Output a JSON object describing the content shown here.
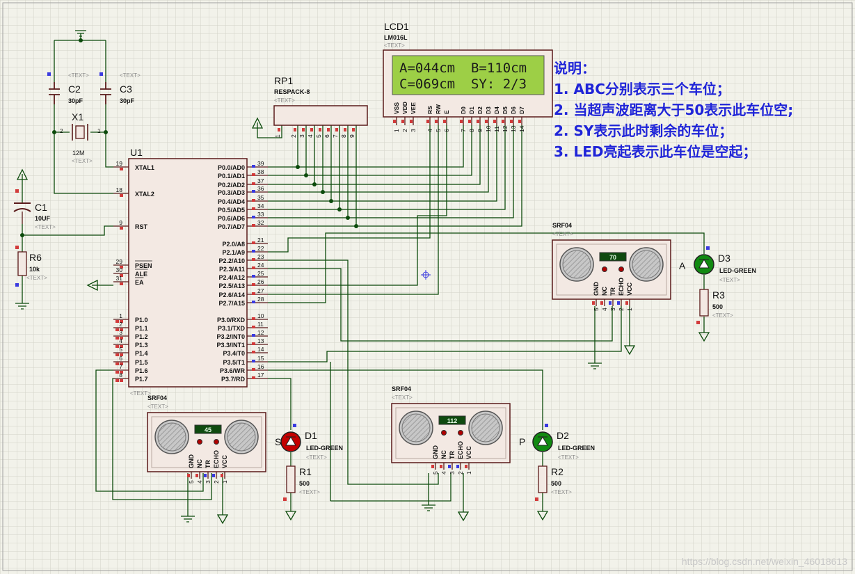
{
  "lcd": {
    "ref": "LCD1",
    "model": "LM016L",
    "text_tag": "<TEXT>",
    "line1": "A=044cm  B=110cm",
    "line2": "C=069cm  SY: 2/3",
    "pins": [
      "VSS",
      "VDD",
      "VEE",
      "RS",
      "RW",
      "E",
      "D0",
      "D1",
      "D2",
      "D3",
      "D4",
      "D5",
      "D6",
      "D7"
    ],
    "pin_numbers": [
      "1",
      "2",
      "3",
      "4",
      "5",
      "6",
      "7",
      "8",
      "9",
      "10",
      "11",
      "12",
      "13",
      "14"
    ]
  },
  "description": {
    "title": "说明：",
    "lines": [
      "1. ABC分别表示三个车位；",
      "2. 当超声波距离大于50表示此车位空;",
      "2. SY表示此时剩余的车位；",
      "3. LED亮起表示此车位是空起；"
    ]
  },
  "rp1": {
    "ref": "RP1",
    "model": "RESPACK-8",
    "text_tag": "<TEXT>",
    "pins": [
      "1",
      "2",
      "3",
      "4",
      "5",
      "6",
      "7",
      "8",
      "9"
    ]
  },
  "c2": {
    "ref": "C2",
    "value": "30pF",
    "text_tag": "<TEXT>"
  },
  "c3": {
    "ref": "C3",
    "value": "30pF",
    "text_tag": "<TEXT>"
  },
  "x1": {
    "ref": "X1",
    "value": "12M",
    "text_tag": "<TEXT>",
    "pin_left": "2",
    "pin_right": "1"
  },
  "c1": {
    "ref": "C1",
    "value": "10UF",
    "text_tag": "<TEXT>"
  },
  "r6": {
    "ref": "R6",
    "value": "10k",
    "text_tag": "<TEXT>"
  },
  "u1": {
    "ref": "U1",
    "text_tag": "<TEXT>",
    "left_pins": [
      {
        "num": "19",
        "name": "XTAL1"
      },
      {
        "num": "18",
        "name": "XTAL2"
      },
      {
        "num": "9",
        "name": "RST"
      },
      {
        "num": "29",
        "name": "PSEN"
      },
      {
        "num": "30",
        "name": "ALE"
      },
      {
        "num": "31",
        "name": "EA"
      },
      {
        "num": "1",
        "name": "P1.0"
      },
      {
        "num": "2",
        "name": "P1.1"
      },
      {
        "num": "3",
        "name": "P1.2"
      },
      {
        "num": "4",
        "name": "P1.3"
      },
      {
        "num": "5",
        "name": "P1.4"
      },
      {
        "num": "6",
        "name": "P1.5"
      },
      {
        "num": "7",
        "name": "P1.6"
      },
      {
        "num": "8",
        "name": "P1.7"
      }
    ],
    "right_pins": [
      {
        "num": "39",
        "name": "P0.0/AD0"
      },
      {
        "num": "38",
        "name": "P0.1/AD1"
      },
      {
        "num": "37",
        "name": "P0.2/AD2"
      },
      {
        "num": "36",
        "name": "P0.3/AD3"
      },
      {
        "num": "35",
        "name": "P0.4/AD4"
      },
      {
        "num": "34",
        "name": "P0.5/AD5"
      },
      {
        "num": "33",
        "name": "P0.6/AD6"
      },
      {
        "num": "32",
        "name": "P0.7/AD7"
      },
      {
        "num": "21",
        "name": "P2.0/A8"
      },
      {
        "num": "22",
        "name": "P2.1/A9"
      },
      {
        "num": "23",
        "name": "P2.2/A10"
      },
      {
        "num": "24",
        "name": "P2.3/A11"
      },
      {
        "num": "25",
        "name": "P2.4/A12"
      },
      {
        "num": "26",
        "name": "P2.5/A13"
      },
      {
        "num": "27",
        "name": "P2.6/A14"
      },
      {
        "num": "28",
        "name": "P2.7/A15"
      },
      {
        "num": "10",
        "name": "P3.0/RXD"
      },
      {
        "num": "11",
        "name": "P3.1/TXD"
      },
      {
        "num": "12",
        "name": "P3.2/INT0"
      },
      {
        "num": "13",
        "name": "P3.3/INT1"
      },
      {
        "num": "14",
        "name": "P3.4/T0"
      },
      {
        "num": "15",
        "name": "P3.5/T1"
      },
      {
        "num": "16",
        "name": "P3.6/WR"
      },
      {
        "num": "17",
        "name": "P3.7/RD"
      }
    ]
  },
  "sensors": [
    {
      "model": "SRF04",
      "text_tag": "<TEXT>",
      "reading": "70",
      "pins": [
        "GND",
        "NC",
        "TR",
        "ECHO",
        "VCC"
      ],
      "pin_numbers": [
        "5",
        "4",
        "3",
        "2",
        "1"
      ]
    },
    {
      "model": "SRF04",
      "text_tag": "<TEXT>",
      "reading": "45",
      "pins": [
        "GND",
        "NC",
        "TR",
        "ECHO",
        "VCC"
      ],
      "pin_numbers": [
        "5",
        "4",
        "3",
        "2",
        "1"
      ]
    },
    {
      "model": "SRF04",
      "text_tag": "<TEXT>",
      "reading": "112",
      "pins": [
        "GND",
        "NC",
        "TR",
        "ECHO",
        "VCC"
      ],
      "pin_numbers": [
        "5",
        "4",
        "3",
        "2",
        "1"
      ]
    }
  ],
  "leds": [
    {
      "ref": "D3",
      "model": "LED-GREEN",
      "text_tag": "<TEXT>",
      "label": "A",
      "state": "on"
    },
    {
      "ref": "D1",
      "model": "LED-GREEN",
      "text_tag": "<TEXT>",
      "label": "S",
      "state": "off"
    },
    {
      "ref": "D2",
      "model": "LED-GREEN",
      "text_tag": "<TEXT>",
      "label": "P",
      "state": "on"
    }
  ],
  "resistors": [
    {
      "ref": "R3",
      "value": "500",
      "text_tag": "<TEXT>"
    },
    {
      "ref": "R1",
      "value": "500",
      "text_tag": "<TEXT>"
    },
    {
      "ref": "R2",
      "value": "500",
      "text_tag": "<TEXT>"
    }
  ],
  "colors": {
    "background": "#f2f2ea",
    "grid": "#d3d3c8",
    "wire": "#0b4a0b",
    "body_fill": "#f3e9e3",
    "body_stroke": "#5a1a1a",
    "lcd_screen": "#9dcf46",
    "lcd_text": "#1a1a1a",
    "led_on": "#118a11",
    "led_off": "#c40000",
    "description": "#1f24d8"
  },
  "watermark": "https://blog.csdn.net/weixin_46018613"
}
